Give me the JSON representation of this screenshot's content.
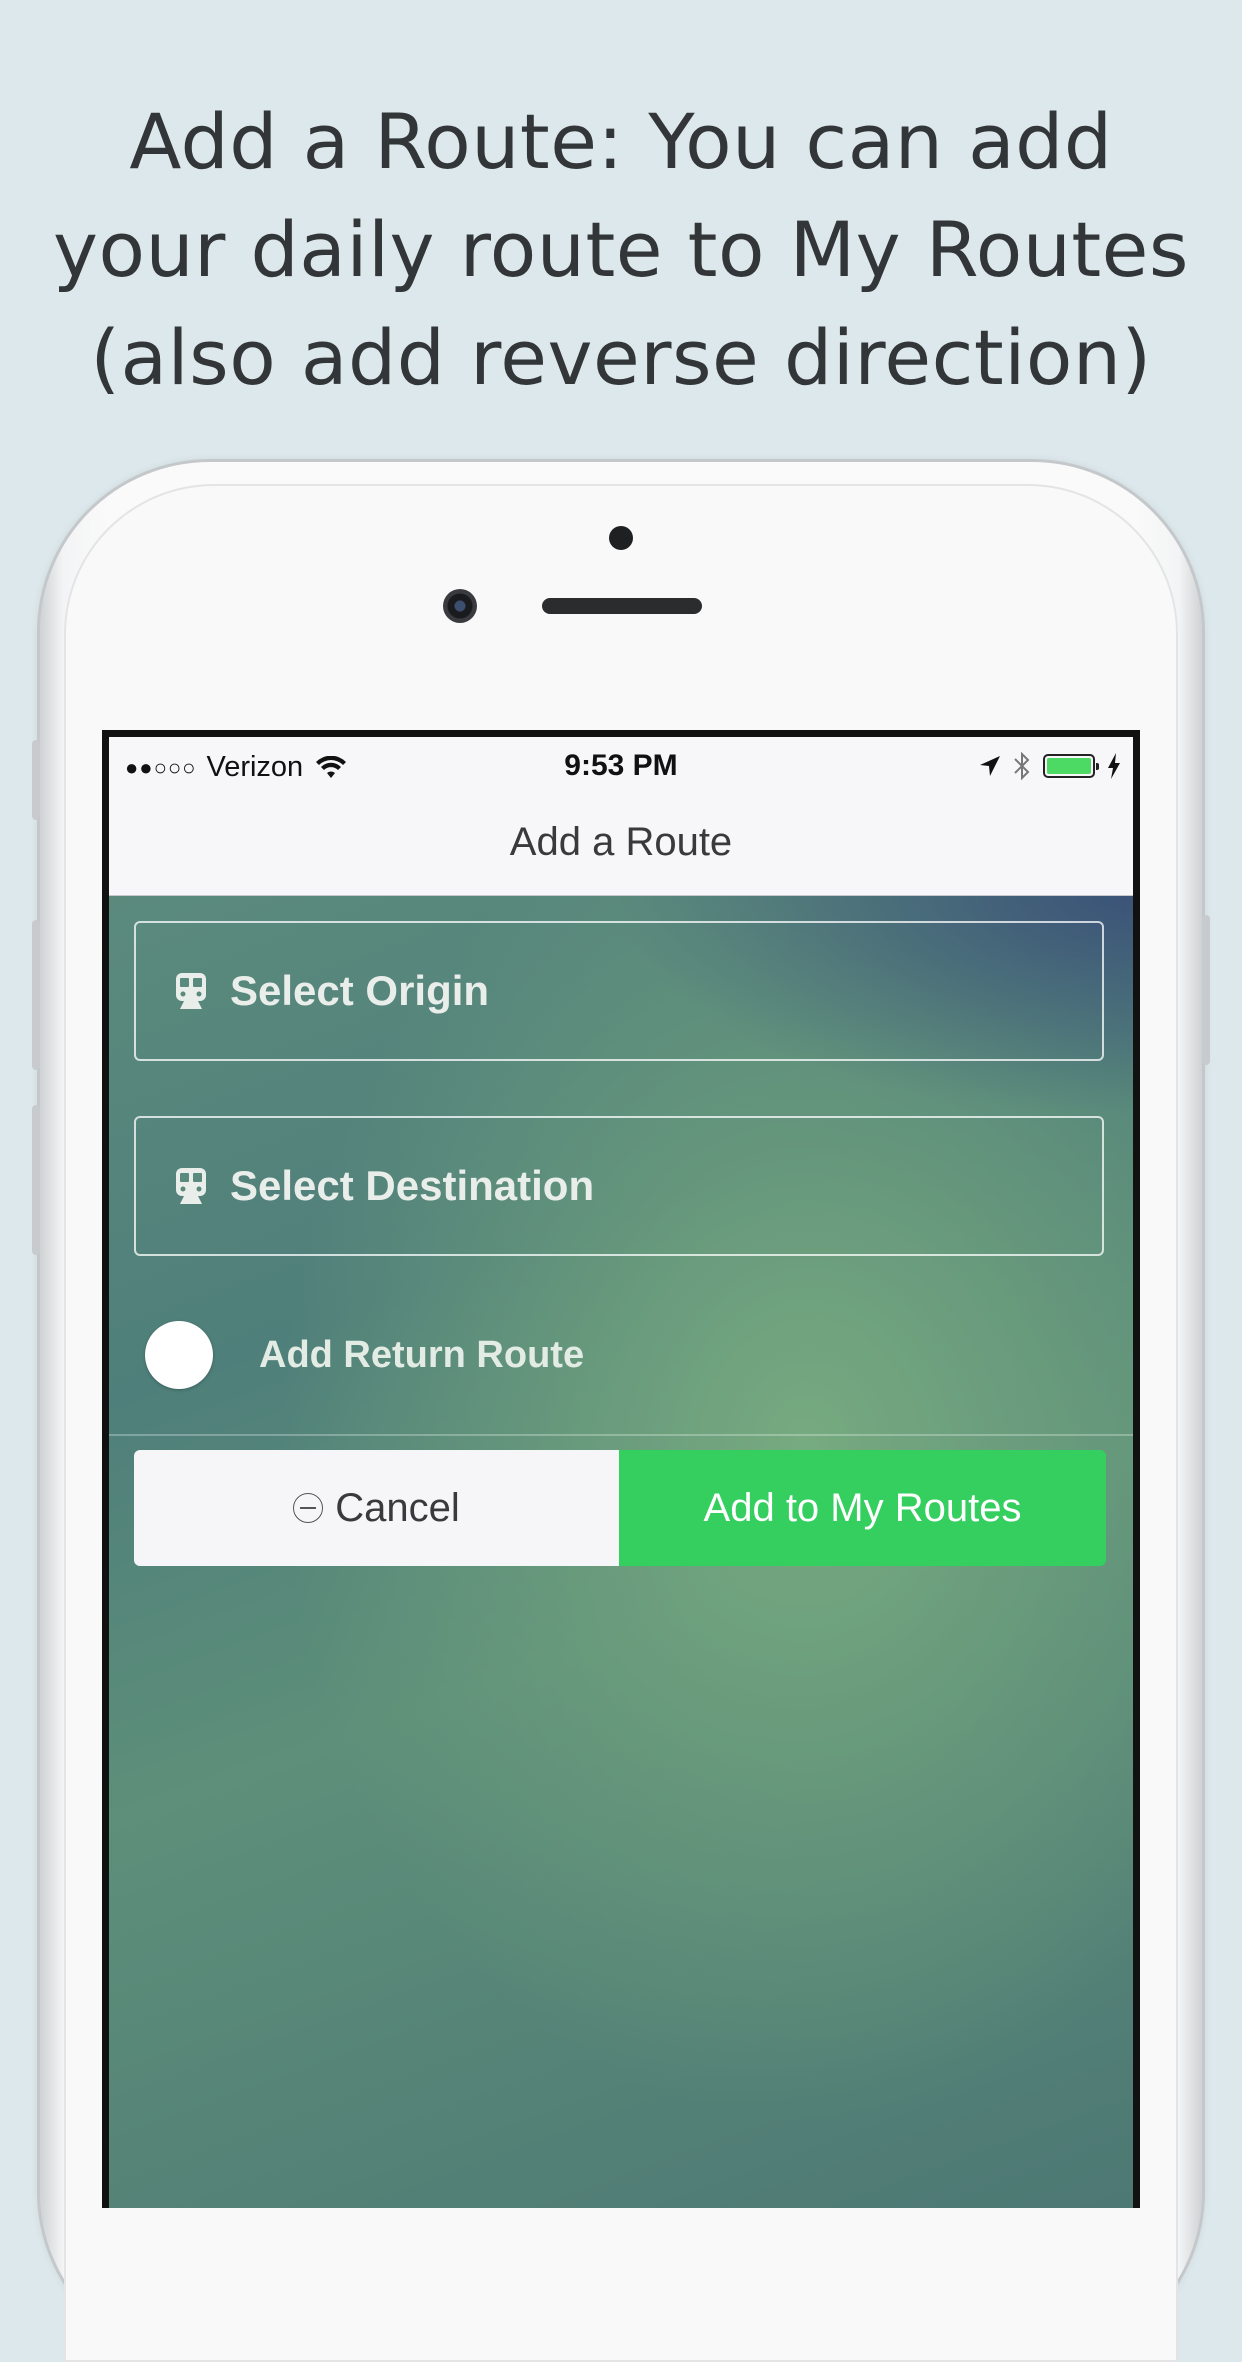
{
  "caption": "Add a Route: You can add your daily route to My Routes (also add reverse direction)",
  "status_bar": {
    "signal": "●●○○○",
    "carrier": "Verizon",
    "time": "9:53 PM"
  },
  "nav": {
    "title": "Add a Route"
  },
  "form": {
    "origin_label": "Select Origin",
    "destination_label": "Select Destination",
    "return_route_label": "Add Return Route",
    "return_route_on": false
  },
  "buttons": {
    "cancel_label": "Cancel",
    "add_label": "Add to My Routes"
  },
  "colors": {
    "add_button": "#34cf5f",
    "battery": "#4cd964"
  },
  "icons": [
    "wifi-icon",
    "location-arrow-icon",
    "bluetooth-icon",
    "battery-icon",
    "charging-bolt-icon",
    "train-icon",
    "minus-circle-icon"
  ]
}
